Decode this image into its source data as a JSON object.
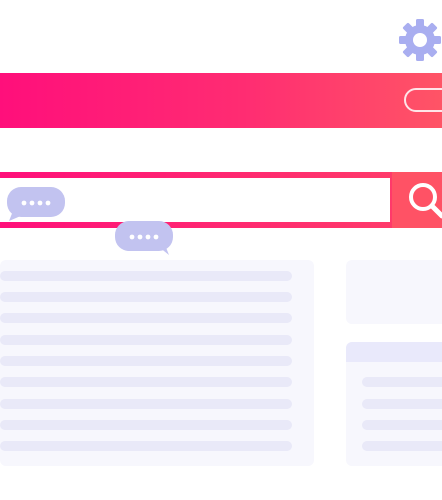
{
  "icons": {
    "settings": "gear-icon",
    "search": "search-icon",
    "chat_bubble": "chat-bubble-icon"
  },
  "colors": {
    "brand_gradient_start": "#ff0f7b",
    "brand_gradient_end": "#ff5466",
    "search_button": "#ff5265",
    "bubble": "#c2c3f0",
    "gear": "#a8aef0",
    "placeholder_line": "#e9e9f8",
    "card_background": "#f7f7fd"
  },
  "search": {
    "value": "",
    "placeholder": ""
  }
}
